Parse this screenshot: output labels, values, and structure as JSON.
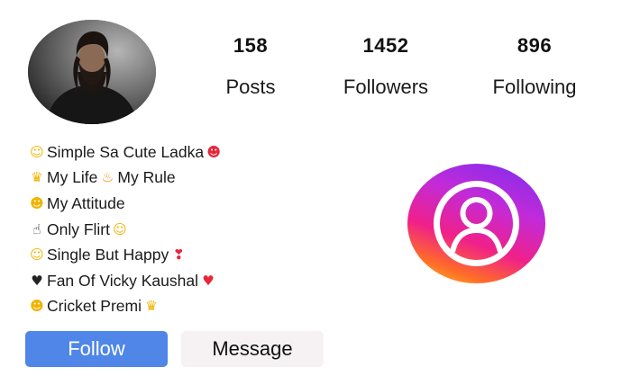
{
  "profile": {
    "avatar_icon": "profile-photo-man-beard",
    "stats": {
      "posts": {
        "count": "158",
        "label": "Posts"
      },
      "followers": {
        "count": "1452",
        "label": "Followers"
      },
      "following": {
        "count": "896",
        "label": "Following"
      }
    },
    "bio": [
      {
        "icon": "person-emoji",
        "text": " Simple Sa Cute Ladka",
        "trail_icon": "smiling-hearts-emoji"
      },
      {
        "icon": "crown-emoji",
        "text": "My Life ",
        "mid_icon": "fire-emoji",
        "text2": "My Rule"
      },
      {
        "icon": "sunglasses-emoji",
        "text": "My Attitude"
      },
      {
        "icon": "pointing-up-emoji",
        "text": " Only Flirt",
        "trail_icon": "blushing-emoji"
      },
      {
        "icon": "smiling-hearts-emoji",
        "text": " Single But Happy",
        "trail_icon": "hearts-emoji"
      },
      {
        "icon": "black-heart-emoji",
        "text": "Fan Of Vicky Kaushal ",
        "trail_icon": "red-heart-emoji"
      },
      {
        "icon": "sunglasses-emoji",
        "text": " Cricket Premi ",
        "trail_icon": "crown-emoji"
      }
    ],
    "actions": {
      "follow_label": "Follow",
      "message_label": "Message"
    },
    "logo_icon": "instagram-profile-icon",
    "colors": {
      "follow_button": "#4f86e8",
      "message_button": "#f6f2f3",
      "logo_gradient": [
        "#7a2cf0",
        "#f0208a",
        "#ffc21a"
      ]
    }
  }
}
